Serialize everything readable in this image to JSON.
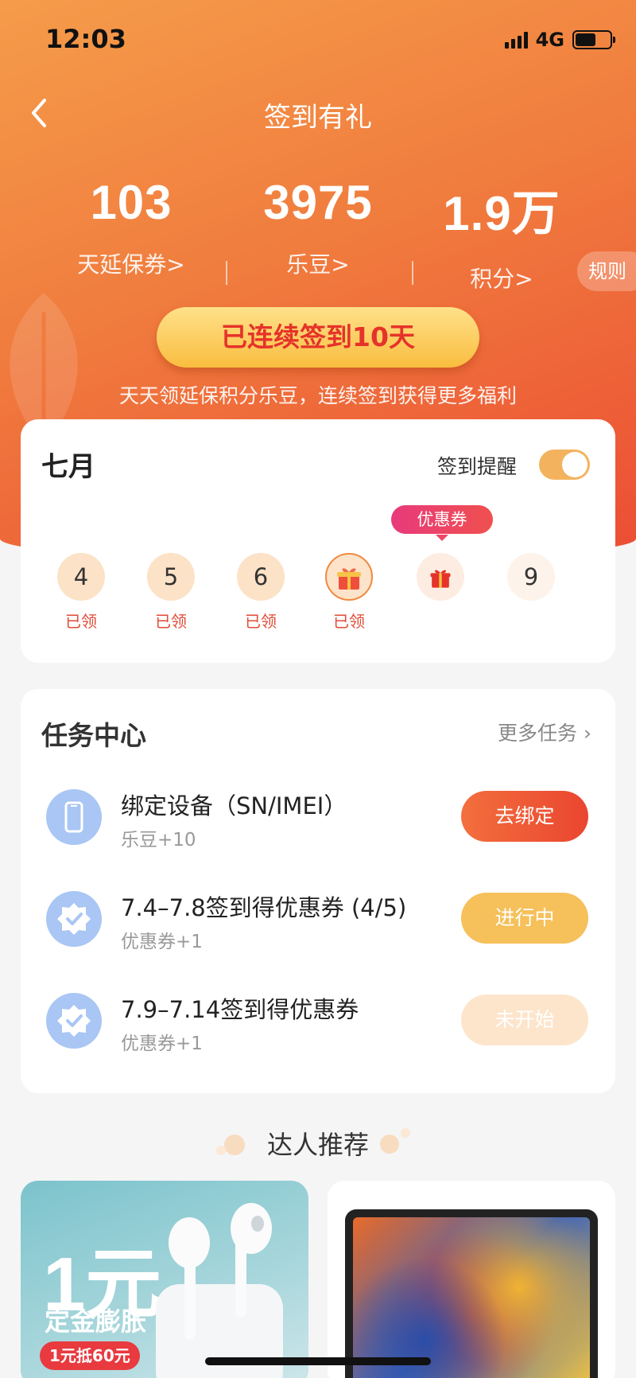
{
  "status_bar": {
    "time": "12:03",
    "network": "4G",
    "battery_level": 0.6
  },
  "header": {
    "title": "签到有礼",
    "back_icon": "chevron-left-icon"
  },
  "stats": [
    {
      "value": "103",
      "label": "天延保券>"
    },
    {
      "value": "3975",
      "label": "乐豆>"
    },
    {
      "value": "1.9万",
      "label": "积分>"
    }
  ],
  "rules_label": "规则",
  "sign_button": "已连续签到10天",
  "tagline": "天天领延保积分乐豆，连续签到获得更多福利",
  "calendar": {
    "month": "七月",
    "reminder_label": "签到提醒",
    "reminder_on": true,
    "coupon_tip": "优惠券",
    "days": [
      {
        "day": "4",
        "status": "已领"
      },
      {
        "day": "5",
        "status": "已领"
      },
      {
        "day": "6",
        "status": "已领"
      },
      {
        "icon": "gift-icon",
        "status": "已领"
      },
      {
        "icon": "gift-icon",
        "status": ""
      },
      {
        "day": "9",
        "status": ""
      }
    ]
  },
  "task_center": {
    "title": "任务中心",
    "more": "更多任务",
    "tasks": [
      {
        "name": "绑定设备（SN/IMEI）",
        "reward": "乐豆+10",
        "action": "去绑定",
        "icon": "phone-icon"
      },
      {
        "name": "7.4–7.8签到得优惠券 (4/5)",
        "reward": "优惠券+1",
        "action": "进行中",
        "icon": "badge-check-icon"
      },
      {
        "name": "7.9–7.14签到得优惠券",
        "reward": "优惠券+1",
        "action": "未开始",
        "icon": "badge-check-icon"
      }
    ]
  },
  "recommend": {
    "title": "达人推荐",
    "products": [
      {
        "headline": "1元",
        "subline": "定金膨胀",
        "badge": "1元抵60元"
      },
      {
        "image": "tablet-image"
      }
    ]
  },
  "colors": {
    "accent": "#ec4d34",
    "gold": "#f9bd3f",
    "toggle": "#f3b35e"
  }
}
